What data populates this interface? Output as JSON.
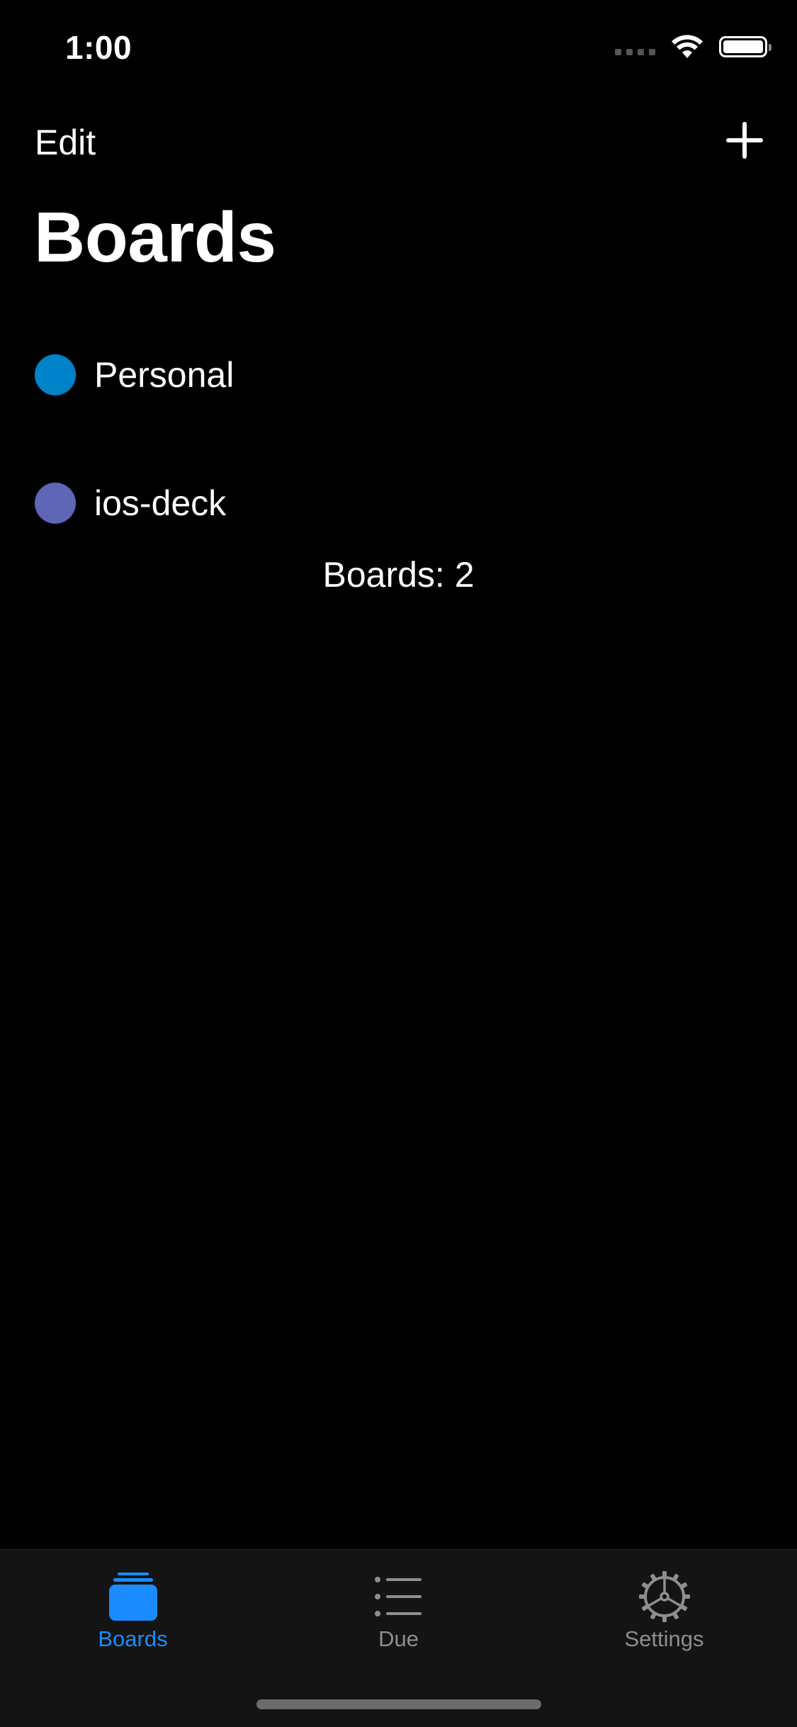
{
  "status_bar": {
    "time": "1:00"
  },
  "nav": {
    "edit_label": "Edit",
    "add_icon": "plus-icon"
  },
  "page": {
    "title": "Boards"
  },
  "boards": [
    {
      "label": "Personal",
      "color": "#0082c9"
    },
    {
      "label": "ios-deck",
      "color": "#5e66b5"
    }
  ],
  "boards_count_text": "Boards: 2",
  "tab_bar": {
    "tabs": [
      {
        "label": "Boards",
        "icon": "boards-stack-icon",
        "active": true
      },
      {
        "label": "Due",
        "icon": "list-icon",
        "active": false
      },
      {
        "label": "Settings",
        "icon": "gear-icon",
        "active": false
      }
    ],
    "active_color": "#1a8cff",
    "inactive_color": "#8e8e93"
  }
}
